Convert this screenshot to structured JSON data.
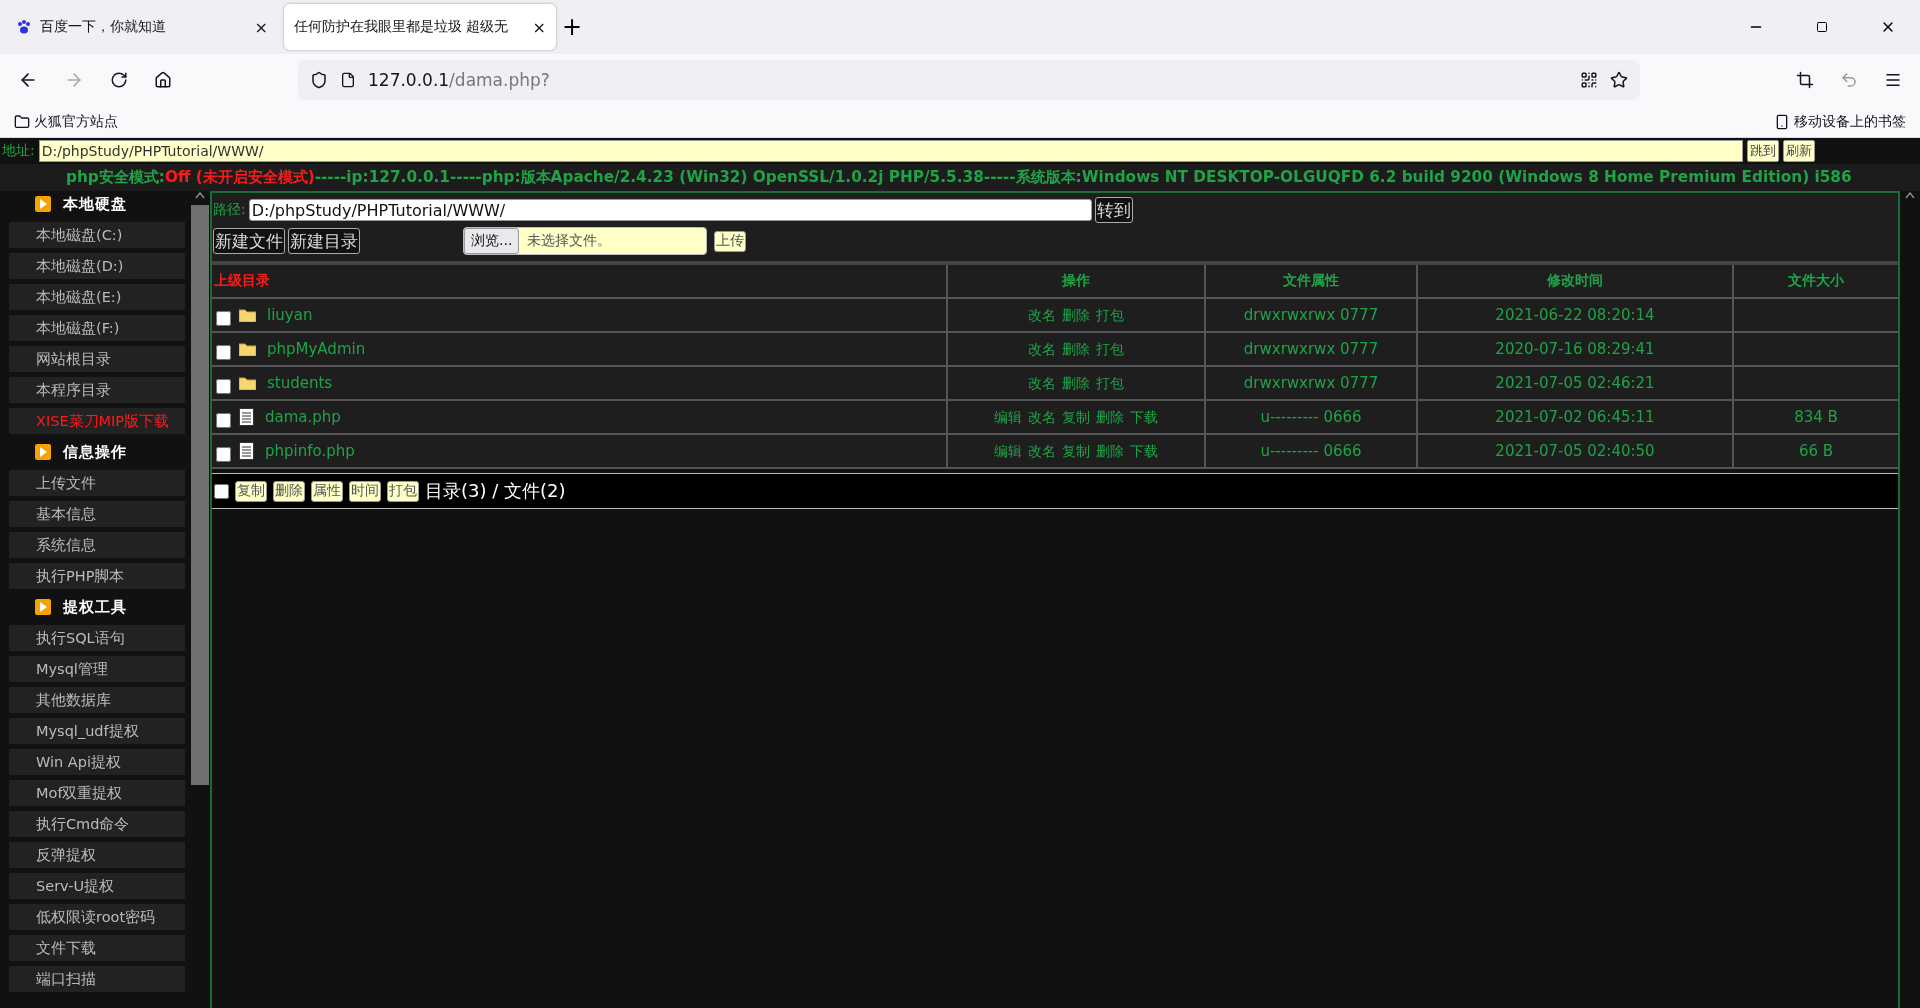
{
  "browser": {
    "tabs": [
      {
        "title": "百度一下，你就知道",
        "selected": false,
        "close": "×"
      },
      {
        "title": "任何防护在我眼里都是垃圾 超级无",
        "selected": true,
        "close": "×"
      }
    ],
    "new_tab": "+",
    "url": {
      "host": "127.0.0.1",
      "path": "/dama.php?"
    },
    "bookmarks": {
      "left": "火狐官方站点",
      "right": "移动设备上的书签"
    }
  },
  "address": {
    "label": "地址:",
    "value": "D:/phpStudy/PHPTutorial/WWW/",
    "buttons": [
      "跳到",
      "刷新"
    ]
  },
  "status": {
    "label": "php安全模式:",
    "value": "Off (未开启安全模式)",
    "rest": "-----ip:127.0.0.1-----php:版本Apache/2.4.23 (Win32) OpenSSL/1.0.2j PHP/5.5.38-----系统版本:Windows NT DESKTOP-OLGUQFD 6.2 build 9200 (Windows 8 Home Premium Edition) i586"
  },
  "sidebar": {
    "groups": [
      {
        "title": "本地硬盘",
        "items": [
          {
            "label": "本地磁盘(C:)",
            "highlight": false
          },
          {
            "label": "本地磁盘(D:)",
            "highlight": false
          },
          {
            "label": "本地磁盘(E:)",
            "highlight": false
          },
          {
            "label": "本地磁盘(F:)",
            "highlight": false
          },
          {
            "label": "网站根目录",
            "highlight": false
          },
          {
            "label": "本程序目录",
            "highlight": false
          },
          {
            "label": "XISE菜刀MIP版下载",
            "highlight": true
          }
        ]
      },
      {
        "title": "信息操作",
        "items": [
          {
            "label": "上传文件",
            "highlight": false
          },
          {
            "label": "基本信息",
            "highlight": false
          },
          {
            "label": "系统信息",
            "highlight": false
          },
          {
            "label": "执行PHP脚本",
            "highlight": false
          }
        ]
      },
      {
        "title": "提权工具",
        "items": [
          {
            "label": "执行SQL语句",
            "highlight": false
          },
          {
            "label": "Mysql管理",
            "highlight": false
          },
          {
            "label": "其他数据库",
            "highlight": false
          },
          {
            "label": "Mysql_udf提权",
            "highlight": false
          },
          {
            "label": "Win Api提权",
            "highlight": false
          },
          {
            "label": "Mof双重提权",
            "highlight": false
          },
          {
            "label": "执行Cmd命令",
            "highlight": false
          },
          {
            "label": "反弹提权",
            "highlight": false
          },
          {
            "label": "Serv-U提权",
            "highlight": false
          },
          {
            "label": "低权限读root密码",
            "highlight": false
          },
          {
            "label": "文件下载",
            "highlight": false
          },
          {
            "label": "端口扫描",
            "highlight": false
          }
        ]
      }
    ]
  },
  "path_bar": {
    "label": "路径:",
    "value": "D:/phpStudy/PHPTutorial/WWW/",
    "go": "转到"
  },
  "toolbar": {
    "buttons": [
      "新建文件",
      "新建目录"
    ],
    "browse": "浏览...",
    "file_placeholder": "未选择文件。",
    "upload": "上传"
  },
  "table": {
    "columns": [
      "上级目录",
      "操作",
      "文件属性",
      "修改时间",
      "文件大小"
    ],
    "rows": [
      {
        "kind": "folder",
        "checked": false,
        "name": "liuyan",
        "actions": [
          "改名",
          "删除",
          "打包"
        ],
        "attr": "drwxrwxrwx 0777",
        "time": "2021-06-22 08:20:14"
      },
      {
        "kind": "folder",
        "checked": false,
        "name": "phpMyAdmin",
        "actions": [
          "改名",
          "删除",
          "打包"
        ],
        "attr": "drwxrwxrwx 0777",
        "time": "2020-07-16 08:29:41"
      },
      {
        "kind": "folder",
        "checked": false,
        "name": "students",
        "actions": [
          "改名",
          "删除",
          "打包"
        ],
        "attr": "drwxrwxrwx 0777",
        "time": "2021-07-05 02:46:21"
      },
      {
        "kind": "file",
        "checked": false,
        "name": "dama.php",
        "actions": [
          "编辑",
          "改名",
          "复制",
          "删除",
          "下载"
        ],
        "attr": "u--------- 0666",
        "time": "2021-07-02 06:45:11",
        "size": "834 B"
      },
      {
        "kind": "file",
        "checked": false,
        "name": "phpinfo.php",
        "actions": [
          "编辑",
          "改名",
          "复制",
          "删除",
          "下载"
        ],
        "attr": "u--------- 0666",
        "time": "2021-07-05 02:40:50",
        "size": "66 B"
      }
    ]
  },
  "footer": {
    "checked": false,
    "buttons": [
      "复制",
      "删除",
      "属性",
      "时间",
      "打包"
    ],
    "summary": "目录(3) / 文件(2)"
  }
}
